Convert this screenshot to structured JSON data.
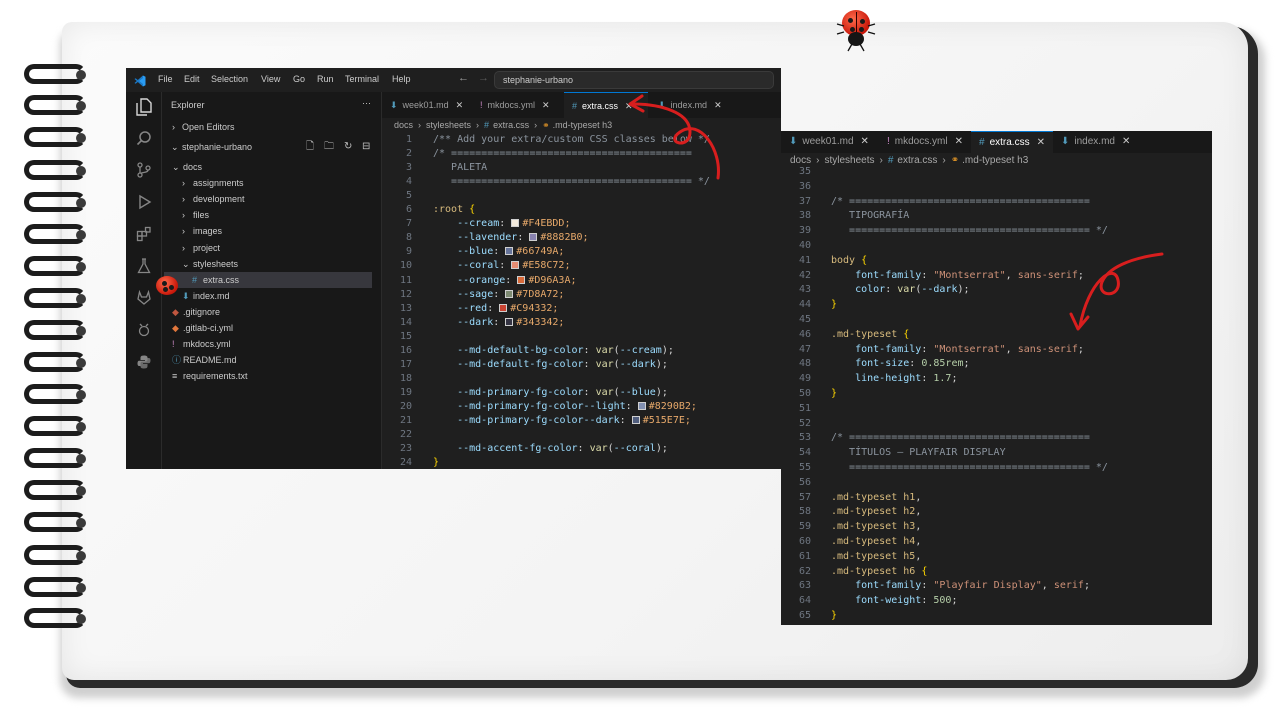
{
  "window1": {
    "menu": [
      "File",
      "Edit",
      "Selection",
      "View",
      "Go",
      "Run",
      "Terminal",
      "Help"
    ],
    "search_text": "stephanie-urbano",
    "explorer_title": "Explorer",
    "explorer_more": "···",
    "open_editors": "Open Editors",
    "workspace": "stephanie-urbano",
    "tree": [
      {
        "label": "docs",
        "type": "folder-open"
      },
      {
        "label": "assignments",
        "type": "folder"
      },
      {
        "label": "development",
        "type": "folder"
      },
      {
        "label": "files",
        "type": "folder"
      },
      {
        "label": "images",
        "type": "folder"
      },
      {
        "label": "project",
        "type": "folder"
      },
      {
        "label": "stylesheets",
        "type": "folder-open"
      },
      {
        "label": "extra.css",
        "type": "css"
      },
      {
        "label": "index.md",
        "type": "md"
      },
      {
        "label": ".gitignore",
        "type": "git"
      },
      {
        "label": ".gitlab-ci.yml",
        "type": "gitlab"
      },
      {
        "label": "mkdocs.yml",
        "type": "yml"
      },
      {
        "label": "README.md",
        "type": "info"
      },
      {
        "label": "requirements.txt",
        "type": "txt"
      }
    ],
    "tabs": [
      {
        "label": "week01.md",
        "icon": "markdown-icon"
      },
      {
        "label": "mkdocs.yml",
        "icon": "yaml-icon"
      },
      {
        "label": "extra.css",
        "icon": "css-icon"
      },
      {
        "label": "index.md",
        "icon": "markdown-icon"
      }
    ],
    "breadcrumb": [
      "docs",
      "stylesheets",
      "extra.css",
      ".md-typeset h3"
    ],
    "code": [
      {
        "n": "1",
        "t": "/** Add your extra/custom CSS classes below */"
      },
      {
        "n": "2",
        "t": "/* ========================================"
      },
      {
        "n": "3",
        "t": "   PALETA"
      },
      {
        "n": "4",
        "t": "   ======================================== */"
      },
      {
        "n": "5",
        "t": ""
      },
      {
        "n": "6",
        "t": ":root {"
      },
      {
        "n": "7",
        "t": "    --cream:",
        "v": "#F4EBDD;",
        "c": "#F4EBDD"
      },
      {
        "n": "8",
        "t": "    --lavender:",
        "v": "#8882B0;",
        "c": "#8882B0"
      },
      {
        "n": "9",
        "t": "    --blue:",
        "v": "#66749A;",
        "c": "#66749A"
      },
      {
        "n": "10",
        "t": "    --coral:",
        "v": "#E58C72;",
        "c": "#E58C72"
      },
      {
        "n": "11",
        "t": "    --orange:",
        "v": "#D96A3A;",
        "c": "#D96A3A"
      },
      {
        "n": "12",
        "t": "    --sage:",
        "v": "#7D8A72;",
        "c": "#7D8A72"
      },
      {
        "n": "13",
        "t": "    --red:",
        "v": "#C94332;",
        "c": "#C94332"
      },
      {
        "n": "14",
        "t": "    --dark:",
        "v": "#343342;",
        "c": "#343342"
      },
      {
        "n": "15",
        "t": ""
      },
      {
        "n": "16",
        "t": "    --md-default-bg-color: var(--cream);"
      },
      {
        "n": "17",
        "t": "    --md-default-fg-color: var(--dark);"
      },
      {
        "n": "18",
        "t": ""
      },
      {
        "n": "19",
        "t": "    --md-primary-fg-color: var(--blue);"
      },
      {
        "n": "20",
        "t": "    --md-primary-fg-color--light:",
        "v": "#8290B2;",
        "c": "#8290B2"
      },
      {
        "n": "21",
        "t": "    --md-primary-fg-color--dark:",
        "v": "#515E7E;",
        "c": "#515E7E"
      },
      {
        "n": "22",
        "t": ""
      },
      {
        "n": "23",
        "t": "    --md-accent-fg-color: var(--coral);"
      },
      {
        "n": "24",
        "t": "}"
      }
    ]
  },
  "window2": {
    "tabs": [
      {
        "label": "week01.md",
        "icon": "markdown-icon"
      },
      {
        "label": "mkdocs.yml",
        "icon": "yaml-icon"
      },
      {
        "label": "extra.css",
        "icon": "css-icon"
      },
      {
        "label": "index.md",
        "icon": "markdown-icon"
      }
    ],
    "breadcrumb": [
      "docs",
      "stylesheets",
      "extra.css",
      ".md-typeset h3"
    ],
    "code": [
      {
        "n": "35",
        "t": ""
      },
      {
        "n": "36",
        "t": ""
      },
      {
        "n": "37",
        "t": "/* ========================================"
      },
      {
        "n": "38",
        "t": "   TIPOGRAFÍA"
      },
      {
        "n": "39",
        "t": "   ======================================== */"
      },
      {
        "n": "40",
        "t": ""
      },
      {
        "n": "41",
        "t": "body {"
      },
      {
        "n": "42",
        "t": "    font-family: \"Montserrat\", sans-serif;"
      },
      {
        "n": "43",
        "t": "    color: var(--dark);"
      },
      {
        "n": "44",
        "t": "}"
      },
      {
        "n": "45",
        "t": ""
      },
      {
        "n": "46",
        "t": ".md-typeset {"
      },
      {
        "n": "47",
        "t": "    font-family: \"Montserrat\", sans-serif;"
      },
      {
        "n": "48",
        "t": "    font-size: 0.85rem;"
      },
      {
        "n": "49",
        "t": "    line-height: 1.7;"
      },
      {
        "n": "50",
        "t": "}"
      },
      {
        "n": "51",
        "t": ""
      },
      {
        "n": "52",
        "t": ""
      },
      {
        "n": "53",
        "t": "/* ========================================"
      },
      {
        "n": "54",
        "t": "   TÍTULOS — PLAYFAIR DISPLAY"
      },
      {
        "n": "55",
        "t": "   ======================================== */"
      },
      {
        "n": "56",
        "t": ""
      },
      {
        "n": "57",
        "t": ".md-typeset h1,"
      },
      {
        "n": "58",
        "t": ".md-typeset h2,"
      },
      {
        "n": "59",
        "t": ".md-typeset h3,"
      },
      {
        "n": "60",
        "t": ".md-typeset h4,"
      },
      {
        "n": "61",
        "t": ".md-typeset h5,"
      },
      {
        "n": "62",
        "t": ".md-typeset h6 {"
      },
      {
        "n": "63",
        "t": "    font-family: \"Playfair Display\", serif;"
      },
      {
        "n": "64",
        "t": "    font-weight: 500;"
      },
      {
        "n": "65",
        "t": "}"
      }
    ]
  },
  "colors": {
    "annotation_red": "#d81e1e",
    "vscode_blue": "#0078d4"
  }
}
